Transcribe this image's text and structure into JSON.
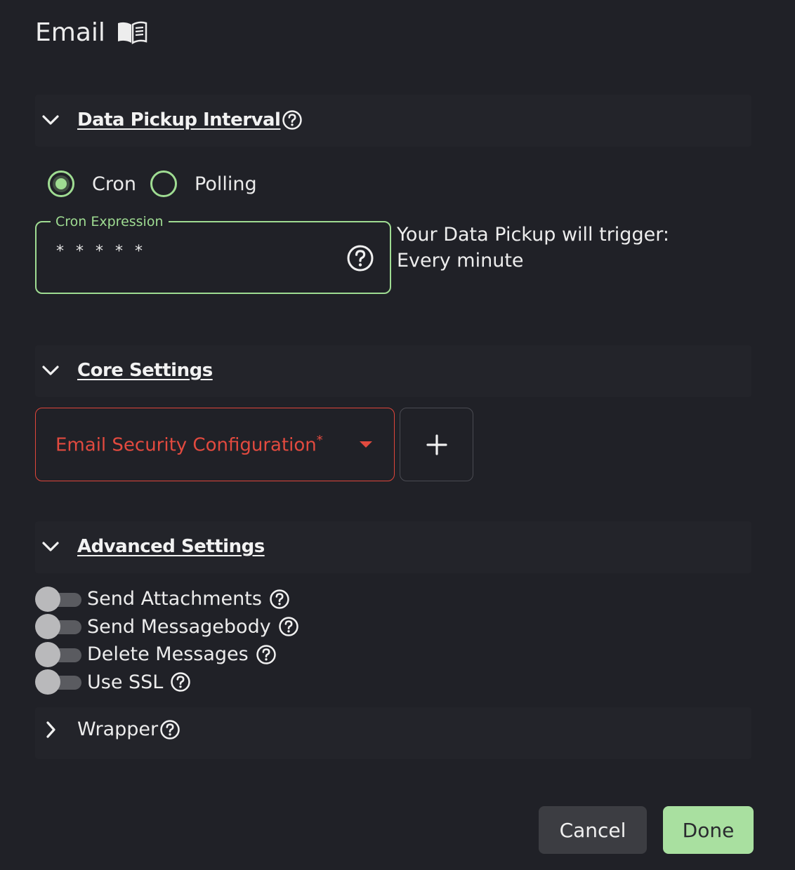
{
  "page": {
    "title": "Email",
    "title_icon": "book-icon"
  },
  "sections": {
    "data_pickup": {
      "title": "Data Pickup Interval",
      "expanded": true
    },
    "core": {
      "title": "Core Settings",
      "expanded": true
    },
    "advanced": {
      "title": "Advanced Settings",
      "expanded": true
    },
    "wrapper": {
      "title": "Wrapper",
      "expanded": false
    }
  },
  "pickup": {
    "options": [
      "Cron",
      "Polling"
    ],
    "selected": "Cron",
    "cron_label": "Cron Expression",
    "cron_value": "* * * * *",
    "trigger_line1": "Your Data Pickup will trigger:",
    "trigger_line2": "Every minute"
  },
  "core": {
    "select_label": "Email Security Configuration",
    "required_mark": "*"
  },
  "advanced": {
    "toggles": [
      {
        "label": "Send Attachments",
        "on": false
      },
      {
        "label": "Send Messagebody",
        "on": false
      },
      {
        "label": "Delete Messages",
        "on": false
      },
      {
        "label": "Use SSL",
        "on": false
      }
    ]
  },
  "footer": {
    "cancel": "Cancel",
    "done": "Done"
  },
  "colors": {
    "accent": "#9fdc92",
    "error": "#e24a3f",
    "background": "#202127",
    "done_bg": "#a9e0a0"
  }
}
